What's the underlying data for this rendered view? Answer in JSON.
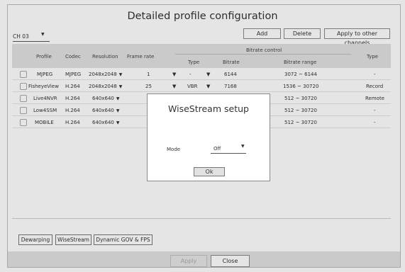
{
  "title": "Detailed profile configuration",
  "channel": {
    "value": "CH 03",
    "arrow": "▼"
  },
  "toolbar": {
    "add": "Add",
    "delete": "Delete",
    "apply_other": "Apply to other channels"
  },
  "table": {
    "headers": {
      "profile": "Profile",
      "codec": "Codec",
      "resolution": "Resolution",
      "frame_rate": "Frame rate",
      "bitrate_control": "Bitrate control",
      "type": "Type",
      "bitrate": "Bitrate",
      "bitrate_range": "Bitrate range",
      "type_right": "Type"
    },
    "rows": [
      {
        "profile": "MJPEG",
        "codec": "MJPEG",
        "resolution": "2048x2048",
        "frame_rate": "1",
        "type": "-",
        "bitrate": "6144",
        "range": "3072 ~ 6144",
        "type_right": "-"
      },
      {
        "profile": "FisheyeView",
        "codec": "H.264",
        "resolution": "2048x2048",
        "frame_rate": "25",
        "type": "VBR",
        "bitrate": "7168",
        "range": "1536 ~ 30720",
        "type_right": "Record"
      },
      {
        "profile": "Live4NVR",
        "codec": "H.264",
        "resolution": "640x640",
        "frame_rate": "",
        "type": "",
        "bitrate": "",
        "range": "512 ~ 30720",
        "type_right": "Remote"
      },
      {
        "profile": "Low4SSM",
        "codec": "H.264",
        "resolution": "640x640",
        "frame_rate": "",
        "type": "",
        "bitrate": "",
        "range": "512 ~ 30720",
        "type_right": "-"
      },
      {
        "profile": "MOBILE",
        "codec": "H.264",
        "resolution": "640x640",
        "frame_rate": "",
        "type": "",
        "bitrate": "",
        "range": "512 ~ 30720",
        "type_right": "-"
      }
    ]
  },
  "tabs": {
    "dewarping": "Dewarping",
    "wisestream": "WiseStream",
    "dynamic_gov": "Dynamic GOV & FPS"
  },
  "footer": {
    "apply": "Apply",
    "close": "Close"
  },
  "dialog": {
    "title": "WiseStream setup",
    "mode_label": "Mode",
    "mode_value": "Off",
    "ok": "Ok"
  }
}
